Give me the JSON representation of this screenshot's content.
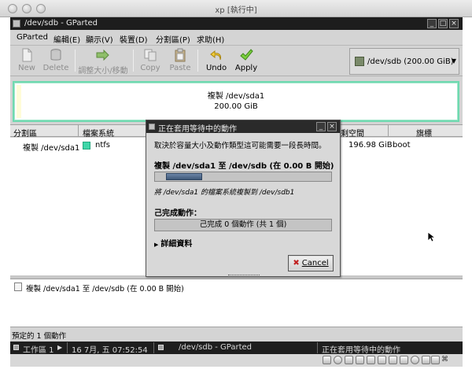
{
  "host_window": {
    "title": "xp [執行中]"
  },
  "app": {
    "title": "/dev/sdb - GParted",
    "menu": [
      "GParted",
      "編輯(E)",
      "顯示(V)",
      "裝置(D)",
      "分割區(P)",
      "求助(H)"
    ],
    "toolbar": {
      "new": "New",
      "delete": "Delete",
      "resize": "調整大小/移動",
      "copy": "Copy",
      "paste": "Paste",
      "undo": "Undo",
      "apply": "Apply"
    },
    "device_selector": {
      "value": "/dev/sdb  (200.00 GiB)"
    },
    "graphic": {
      "line1": "複製 /dev/sda1",
      "line2": "200.00 GiB"
    },
    "partition_table": {
      "columns": {
        "partition": "分割區",
        "filesystem": "檔案系統",
        "unused": "剩空間",
        "flags": "旗標"
      },
      "rows": [
        {
          "partition": "複製 /dev/sda1",
          "filesystem": "ntfs",
          "unused": "196.98 GiB",
          "flags": "boot"
        }
      ]
    },
    "operations": [
      "複製 /dev/sda1 至 /dev/sdb (在 0.00 B 開始)"
    ],
    "statusbar": "預定的 1 個動作"
  },
  "dialog": {
    "title": "正在套用等待中的動作",
    "description": "取決於容量大小及動作類型這可能需要一段長時間。",
    "current_operation": "複製 /dev/sda1 至 /dev/sdb (在 0.00 B 開始)",
    "progress_fraction": 0.22,
    "sub_operation": "將 /dev/sda1 的檔案系統複製到 /dev/sdb1",
    "completed_label": "己完成動作：",
    "completed_status": "己完成 0 個動作 (共 1 個)",
    "details_label": "詳細資料",
    "cancel_label": "Cancel"
  },
  "taskbar": {
    "workspace": "工作區 1",
    "clock": "16 7月, 五 07:52:54",
    "task1": "/dev/sdb - GParted",
    "task2": "正在套用等待中的動作"
  },
  "host_key": "⌘"
}
